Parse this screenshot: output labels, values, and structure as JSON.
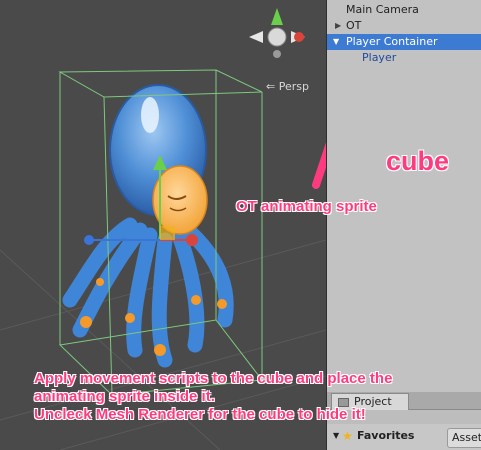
{
  "scene": {
    "view_label": "Persp",
    "gizmo_axes": [
      "y-axis-cone",
      "x-axis-cone",
      "z-axis-cone"
    ]
  },
  "hierarchy": {
    "items": [
      {
        "label": "Main Camera",
        "expanded": null,
        "selected": false
      },
      {
        "label": "OT",
        "expanded": false,
        "selected": false
      },
      {
        "label": "Player Container",
        "expanded": true,
        "selected": true
      },
      {
        "label": "Player",
        "expanded": null,
        "selected": false
      }
    ]
  },
  "project": {
    "tab_label": "Project",
    "favorites_label": "Favorites",
    "assets_label": "Assets"
  },
  "annotations": {
    "cube": "cube",
    "ot_sprite": "OT animating sprite",
    "instructions": [
      "Apply movement scripts to the cube and place the",
      "animating sprite inside it.",
      "Uncleck Mesh Renderer for the cube to hide it!"
    ],
    "color": "#ff3b80"
  },
  "colors": {
    "scene_bg": "#4a4a4a",
    "hierarchy_bg": "#c2c2c2",
    "selection": "#3d7bd3",
    "bounding_box": "#7ec87e"
  }
}
